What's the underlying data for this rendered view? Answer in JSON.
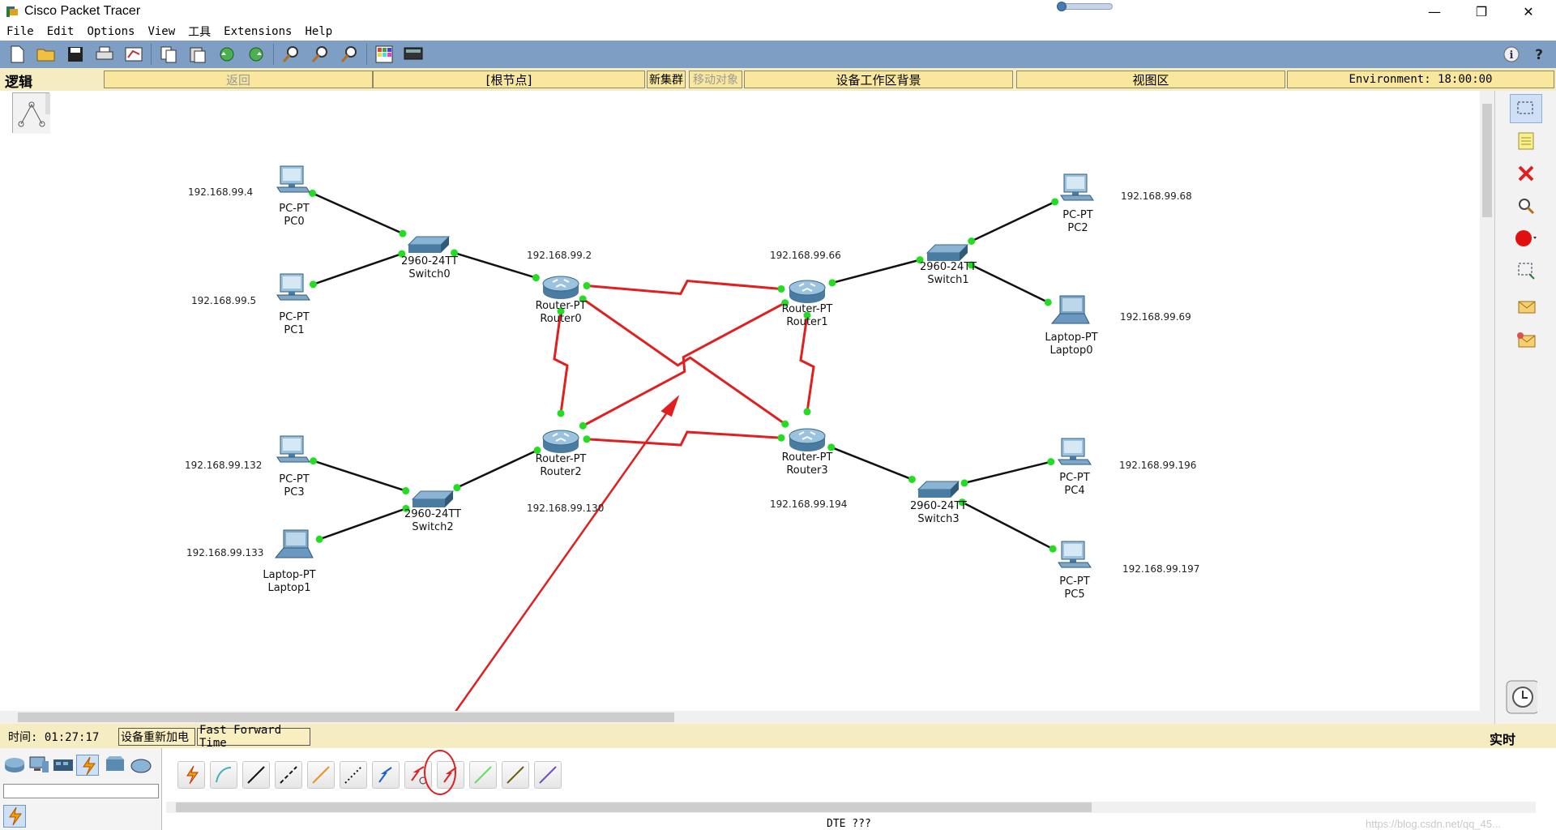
{
  "window": {
    "title": "Cisco Packet Tracer"
  },
  "menu": [
    "File",
    "Edit",
    "Options",
    "View",
    "工具",
    "Extensions",
    "Help"
  ],
  "toolbar": {
    "icons": [
      "new-file-icon",
      "open-folder-icon",
      "save-icon",
      "print-icon",
      "activity-wizard-icon",
      "copy-icon",
      "paste-icon",
      "undo-icon",
      "redo-icon",
      "zoom-in-icon",
      "zoom-reset-icon",
      "zoom-out-icon",
      "palette-icon",
      "device-dialog-icon"
    ]
  },
  "nav": {
    "logic_label": "逻辑",
    "back": "返回",
    "root": "[根节点]",
    "new_cluster": "新集群",
    "move_object": "移动对象",
    "background": "设备工作区背景",
    "viewport": "视图区",
    "environment": "Environment: 18:00:00"
  },
  "devices": [
    {
      "id": "PC0",
      "model": "PC-PT",
      "name": "PC0",
      "ip": "192.168.99.4"
    },
    {
      "id": "PC1",
      "model": "PC-PT",
      "name": "PC1",
      "ip": "192.168.99.5"
    },
    {
      "id": "Switch0",
      "model": "2960-24TT",
      "name": "Switch0"
    },
    {
      "id": "Router0",
      "model": "Router-PT",
      "name": "Router0",
      "ip": "192.168.99.2"
    },
    {
      "id": "Router1",
      "model": "Router-PT",
      "name": "Router1",
      "ip": "192.168.99.66"
    },
    {
      "id": "Switch1",
      "model": "2960-24TT",
      "name": "Switch1"
    },
    {
      "id": "PC2",
      "model": "PC-PT",
      "name": "PC2",
      "ip": "192.168.99.68"
    },
    {
      "id": "Laptop0",
      "model": "Laptop-PT",
      "name": "Laptop0",
      "ip": "192.168.99.69"
    },
    {
      "id": "PC3",
      "model": "PC-PT",
      "name": "PC3",
      "ip": "192.168.99.132"
    },
    {
      "id": "Laptop1",
      "model": "Laptop-PT",
      "name": "Laptop1",
      "ip": "192.168.99.133"
    },
    {
      "id": "Switch2",
      "model": "2960-24TT",
      "name": "Switch2"
    },
    {
      "id": "Router2",
      "model": "Router-PT",
      "name": "Router2",
      "ip": "192.168.99.130"
    },
    {
      "id": "Router3",
      "model": "Router-PT",
      "name": "Router3",
      "ip": "192.168.99.194"
    },
    {
      "id": "Switch3",
      "model": "2960-24TT",
      "name": "Switch3"
    },
    {
      "id": "PC4",
      "model": "PC-PT",
      "name": "PC4",
      "ip": "192.168.99.196"
    },
    {
      "id": "PC5",
      "model": "PC-PT",
      "name": "PC5",
      "ip": "192.168.99.197"
    }
  ],
  "links": [
    {
      "from": "PC0",
      "to": "Switch0",
      "type": "copper"
    },
    {
      "from": "PC1",
      "to": "Switch0",
      "type": "copper"
    },
    {
      "from": "Switch0",
      "to": "Router0",
      "type": "copper"
    },
    {
      "from": "Router0",
      "to": "Router1",
      "type": "serial"
    },
    {
      "from": "Router0",
      "to": "Router2",
      "type": "serial"
    },
    {
      "from": "Router0",
      "to": "Router3",
      "type": "serial"
    },
    {
      "from": "Router2",
      "to": "Router1",
      "type": "serial"
    },
    {
      "from": "Router2",
      "to": "Router3",
      "type": "serial"
    },
    {
      "from": "Router1",
      "to": "Router3",
      "type": "serial"
    },
    {
      "from": "Router1",
      "to": "Switch1",
      "type": "copper"
    },
    {
      "from": "Switch1",
      "to": "PC2",
      "type": "copper"
    },
    {
      "from": "Switch1",
      "to": "Laptop0",
      "type": "copper"
    },
    {
      "from": "PC3",
      "to": "Switch2",
      "type": "copper"
    },
    {
      "from": "Laptop1",
      "to": "Switch2",
      "type": "copper"
    },
    {
      "from": "Switch2",
      "to": "Router2",
      "type": "copper"
    },
    {
      "from": "Router3",
      "to": "Switch3",
      "type": "copper"
    },
    {
      "from": "Switch3",
      "to": "PC4",
      "type": "copper"
    },
    {
      "from": "Switch3",
      "to": "PC5",
      "type": "copper"
    }
  ],
  "status": {
    "time": "时间: 01:27:17",
    "power_cycle": "设备重新加电",
    "fast_forward": "Fast Forward Time",
    "mode": "实时"
  },
  "bottom": {
    "selected_cable": "DTE ???",
    "watermark": "https://blog.csdn.net/qq_45..."
  },
  "colors": {
    "serial": "#e02020",
    "copper": "#111111",
    "port_up": "#22dd22",
    "toolbar": "#7e9ec4",
    "nav": "#f9e79e"
  }
}
